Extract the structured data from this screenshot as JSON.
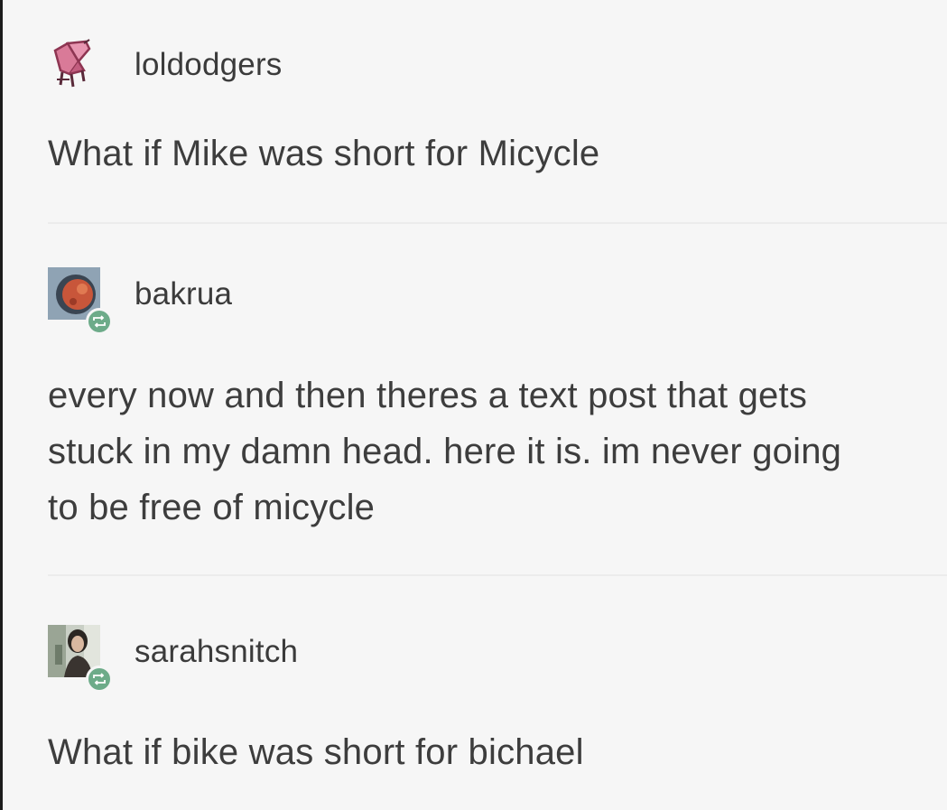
{
  "posts": [
    {
      "username": "loldodgers",
      "text": "What if Mike was short for Micycle",
      "avatar_icon": "pink-chair-avatar-icon",
      "reblogged": false
    },
    {
      "username": "bakrua",
      "text": "every now and then theres a text post that gets stuck in my damn head. here it is. im never going to be free of micycle",
      "avatar_icon": "orange-circle-avatar-icon",
      "reblogged": true
    },
    {
      "username": "sarahsnitch",
      "text": "What if bike was short for bichael",
      "avatar_icon": "photo-avatar-icon",
      "reblogged": true
    }
  ],
  "colors": {
    "background": "#f6f6f6",
    "text": "#3d3d3d",
    "reblog_badge": "#6dab89",
    "avatar_pink": "#c96b8a"
  }
}
